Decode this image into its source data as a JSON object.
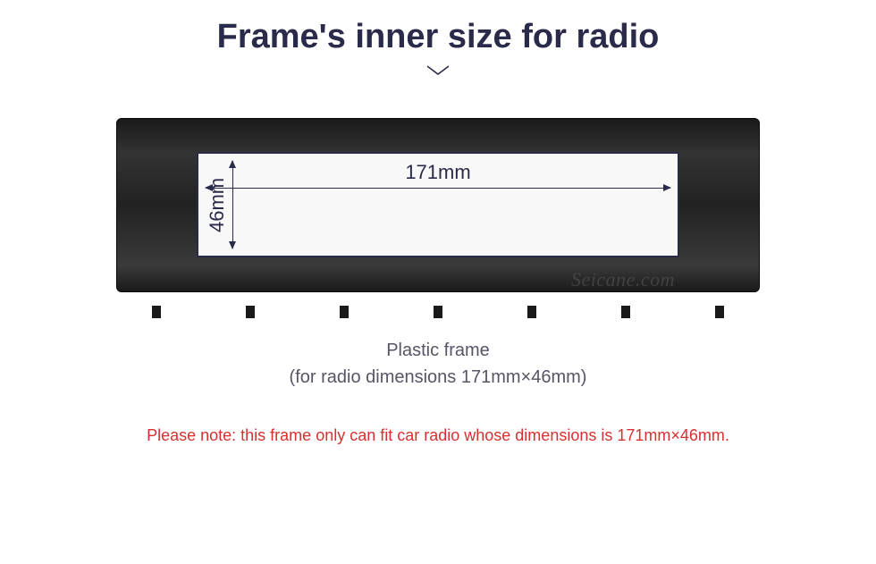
{
  "title": "Frame's inner size for radio",
  "dimensions": {
    "width_label": "171mm",
    "height_label": "46mm"
  },
  "watermark": "Seicane.com",
  "subtitle_line1": "Plastic frame",
  "subtitle_line2": "(for radio dimensions 171mm×46mm)",
  "note": "Please note: this frame only can fit car radio whose dimensions is 171mm×46mm."
}
